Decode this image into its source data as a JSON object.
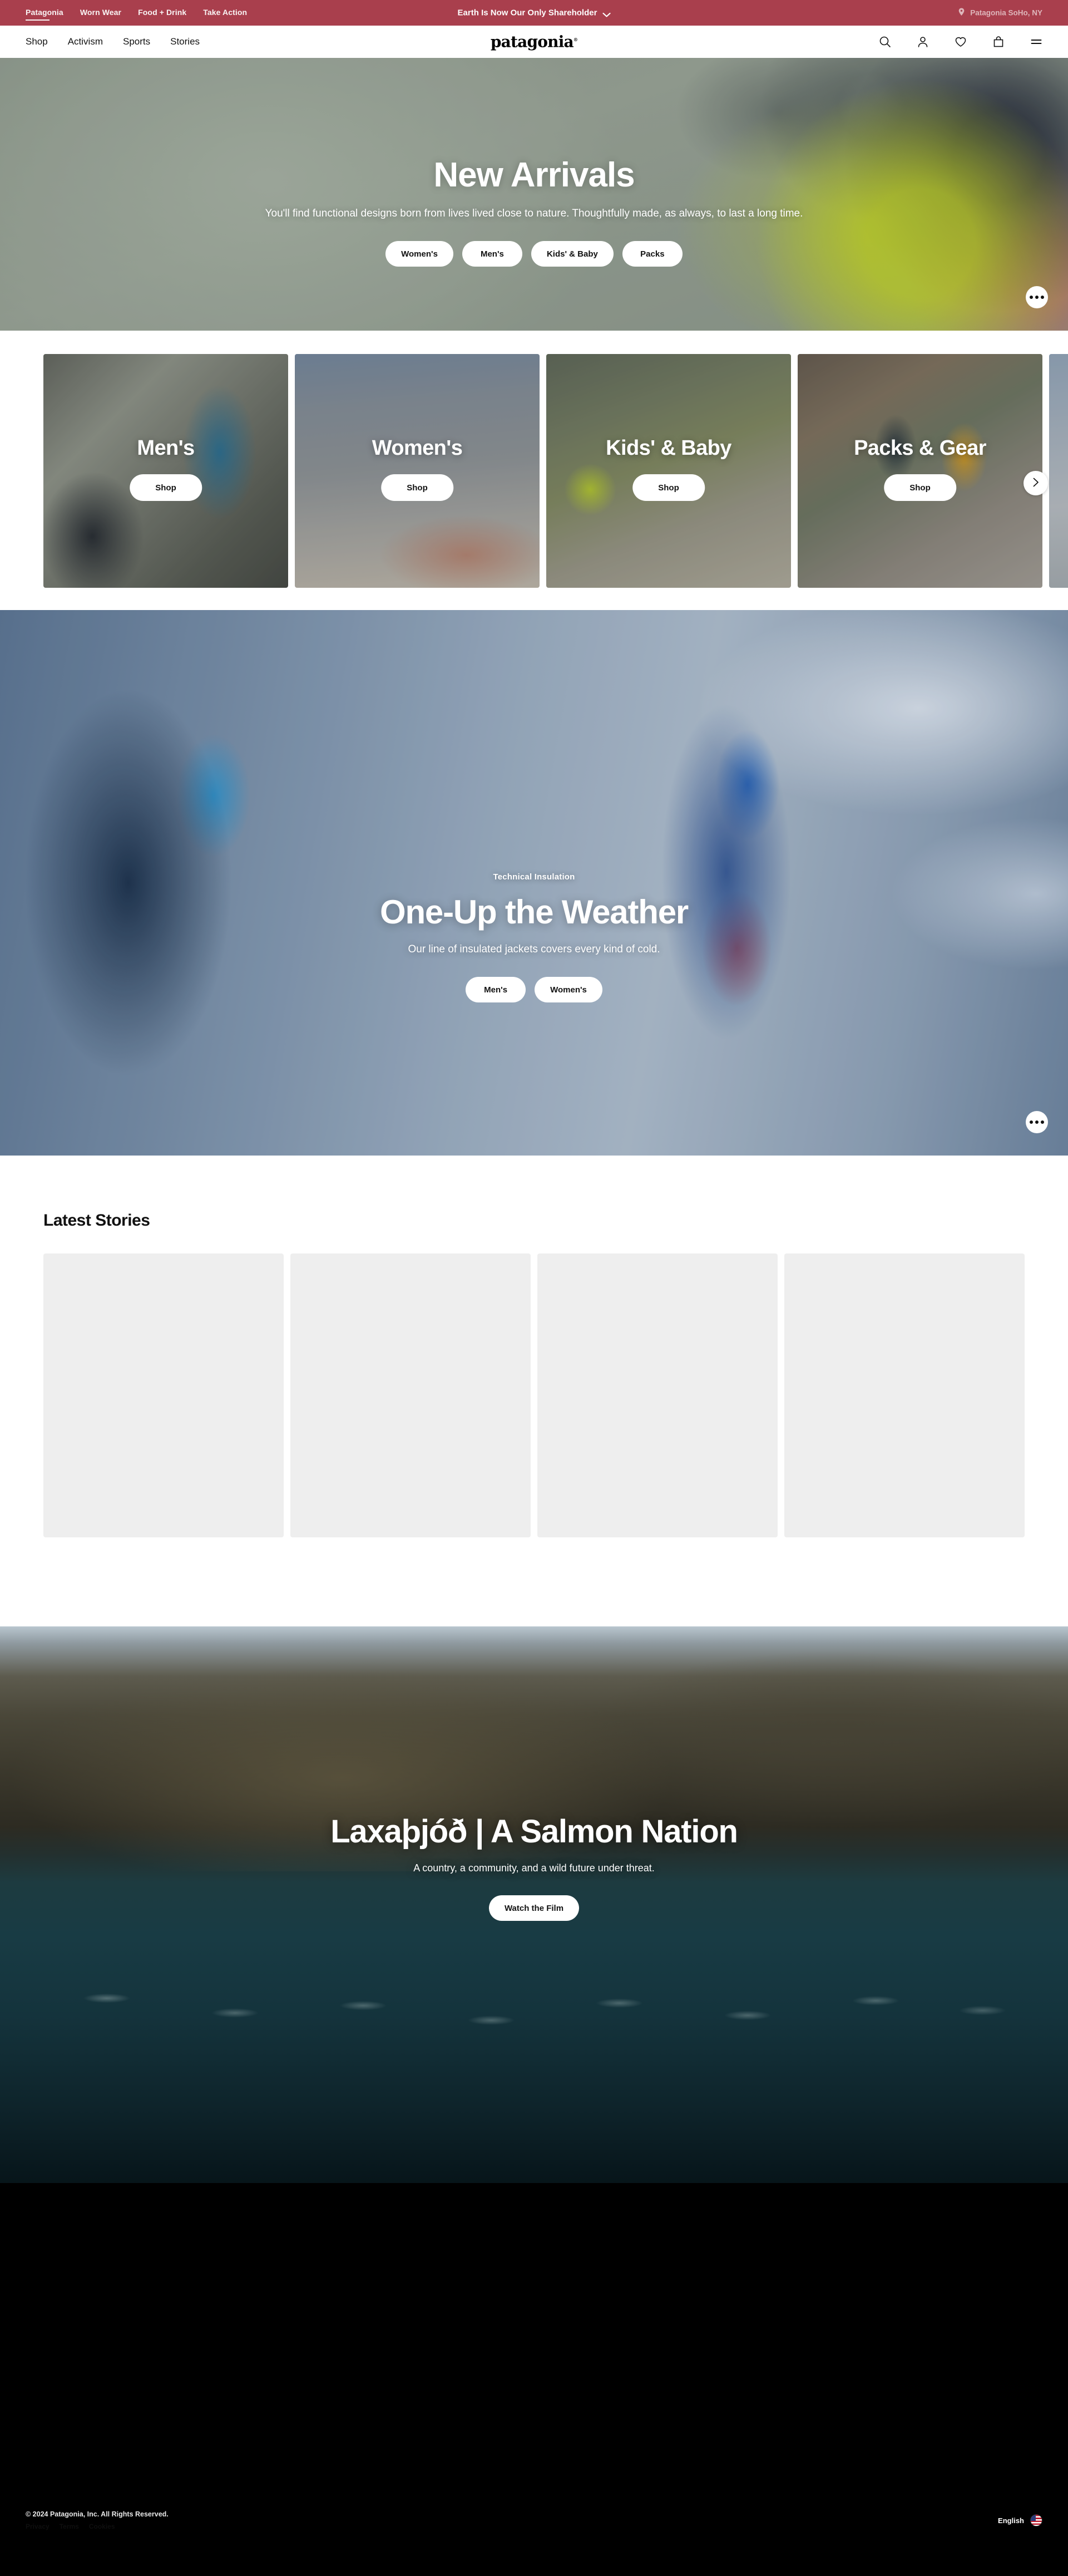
{
  "announcement": {
    "links": [
      {
        "label": "Patagonia",
        "active": true
      },
      {
        "label": "Worn Wear",
        "active": false
      },
      {
        "label": "Food + Drink",
        "active": false
      },
      {
        "label": "Take Action",
        "active": false
      }
    ],
    "message": "Earth Is Now Our Only Shareholder",
    "store": "Patagonia SoHo, NY",
    "store_icon": "location-pin-icon",
    "chevron_icon": "chevron-down-icon",
    "bg_color": "#A93F4D"
  },
  "nav": {
    "links": [
      "Shop",
      "Activism",
      "Sports",
      "Stories"
    ],
    "brand": "patagonia",
    "brand_mark": "®",
    "icons": [
      {
        "name": "search-icon",
        "label": "Search"
      },
      {
        "name": "user-account-icon",
        "label": "Account"
      },
      {
        "name": "heart-wishlist-icon",
        "label": "Wishlist"
      },
      {
        "name": "shopping-bag-icon",
        "label": "Cart"
      },
      {
        "name": "hamburger-menu-icon",
        "label": "Menu"
      }
    ]
  },
  "hero_new_arrivals": {
    "title": "New Arrivals",
    "subtitle": "You'll find functional designs born from lives lived close to nature. Thoughtfully made, as always, to last a long time.",
    "buttons": [
      "Women's",
      "Men's",
      "Kids' & Baby",
      "Packs"
    ],
    "more_icon": "ellipsis-icon"
  },
  "categories": {
    "cards": [
      {
        "label": "Men's",
        "cta": "Shop",
        "img": "img-mens"
      },
      {
        "label": "Women's",
        "cta": "Shop",
        "img": "img-womens"
      },
      {
        "label": "Kids' & Baby",
        "cta": "Shop",
        "img": "img-kids"
      },
      {
        "label": "Packs & Gear",
        "cta": "Shop",
        "img": "img-packs"
      }
    ],
    "next_icon": "chevron-right-icon"
  },
  "hero_weather": {
    "eyebrow": "Technical Insulation",
    "title": "One-Up the Weather",
    "subtitle": "Our line of insulated jackets covers every kind of cold.",
    "buttons": [
      "Men's",
      "Women's"
    ],
    "more_icon": "ellipsis-icon"
  },
  "stories": {
    "title": "Latest Stories",
    "cards": [
      {
        "placeholder": true
      },
      {
        "placeholder": true
      },
      {
        "placeholder": true
      },
      {
        "placeholder": true
      }
    ]
  },
  "hero_salmon": {
    "title": "Laxaþjóð | A Salmon Nation",
    "subtitle": "A country, a community, and a wild future under threat.",
    "button": "Watch the Film"
  },
  "footer": {
    "copyright": "© 2024 Patagonia, Inc. All Rights Reserved.",
    "links": [
      "Privacy",
      "Terms",
      "Cookies"
    ],
    "language": "English",
    "flag_icon": "us-flag-icon",
    "bg_color": "#000000"
  }
}
